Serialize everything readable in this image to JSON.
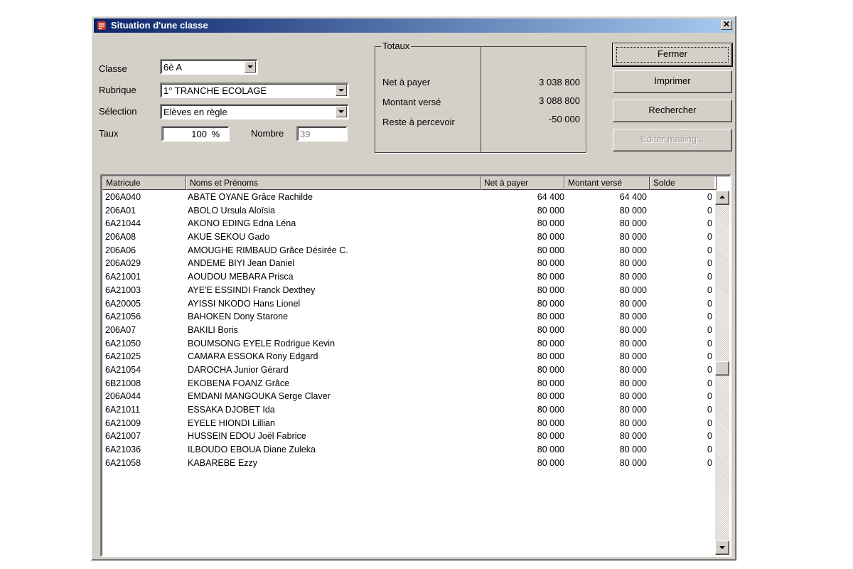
{
  "window": {
    "title": "Situation d'une classe",
    "close_glyph": "✕"
  },
  "filters": {
    "classe_label": "Classe",
    "classe_value": "6è A",
    "rubrique_label": "Rubrique",
    "rubrique_value": "1° TRANCHE ECOLAGE",
    "selection_label": "Sélection",
    "selection_value": "Elèves en règle",
    "taux_label": "Taux",
    "taux_value": "100",
    "taux_unit": "%",
    "nombre_label": "Nombre",
    "nombre_value": "39"
  },
  "totaux": {
    "title": "Totaux",
    "net_label": "Net à payer",
    "net_value": "3 038 800",
    "verse_label": "Montant versé",
    "verse_value": "3 088 800",
    "reste_label": "Reste à percevoir",
    "reste_value": "-50 000"
  },
  "buttons": {
    "fermer": "Fermer",
    "imprimer": "Imprimer",
    "rechercher": "Rechercher",
    "editer": "Editer mailing..."
  },
  "table": {
    "columns": [
      "Matricule",
      "Noms et Prénoms",
      "Net à payer",
      "Montant versé",
      "Solde"
    ],
    "rows": [
      [
        "206A040",
        "ABATE OYANE Grâce Rachilde",
        "64 400",
        "64 400",
        "0"
      ],
      [
        "206A01",
        "ABOLO Ursula Aloïsia",
        "80 000",
        "80 000",
        "0"
      ],
      [
        "6A21044",
        "AKONO EDING Edna Léna",
        "80 000",
        "80 000",
        "0"
      ],
      [
        "206A08",
        "AKUE SEKOU Gado",
        "80 000",
        "80 000",
        "0"
      ],
      [
        "206A06",
        "AMOUGHE RIMBAUD Grâce Désirée C.",
        "80 000",
        "80 000",
        "0"
      ],
      [
        "206A029",
        "ANDEME BIYI Jean Daniel",
        "80 000",
        "80 000",
        "0"
      ],
      [
        "6A21001",
        "AOUDOU MEBARA Prisca",
        "80 000",
        "80 000",
        "0"
      ],
      [
        "6A21003",
        "AYE'E ESSINDI Franck Dexthey",
        "80 000",
        "80 000",
        "0"
      ],
      [
        "6A20005",
        "AYISSI NKODO Hans Lionel",
        "80 000",
        "80 000",
        "0"
      ],
      [
        "6A21056",
        "BAHOKEN Dony Starone",
        "80 000",
        "80 000",
        "0"
      ],
      [
        "206A07",
        "BAKILI Boris",
        "80 000",
        "80 000",
        "0"
      ],
      [
        "6A21050",
        "BOUMSONG EYELE Rodrigue Kevin",
        "80 000",
        "80 000",
        "0"
      ],
      [
        "6A21025",
        "CAMARA ESSOKA Rony Edgard",
        "80 000",
        "80 000",
        "0"
      ],
      [
        "6A21054",
        "DAROCHA Junior Gérard",
        "80 000",
        "80 000",
        "0"
      ],
      [
        "6B21008",
        "EKOBENA FOANZ Grâce",
        "80 000",
        "80 000",
        "0"
      ],
      [
        "206A044",
        "EMDANI MANGOUKA Serge  Claver",
        "80 000",
        "80 000",
        "0"
      ],
      [
        "6A21011",
        "ESSAKA DJOBET Ida",
        "80 000",
        "80 000",
        "0"
      ],
      [
        "6A21009",
        "EYELE HIONDI Lillian",
        "80 000",
        "80 000",
        "0"
      ],
      [
        "6A21007",
        "HUSSEIN EDOU Joël Fabrice",
        "80 000",
        "80 000",
        "0"
      ],
      [
        "6A21036",
        "ILBOUDO EBOUA Diane Zuleka",
        "80 000",
        "80 000",
        "0"
      ],
      [
        "6A21058",
        "KABAREBE Ezzy",
        "80 000",
        "80 000",
        "0"
      ]
    ]
  }
}
